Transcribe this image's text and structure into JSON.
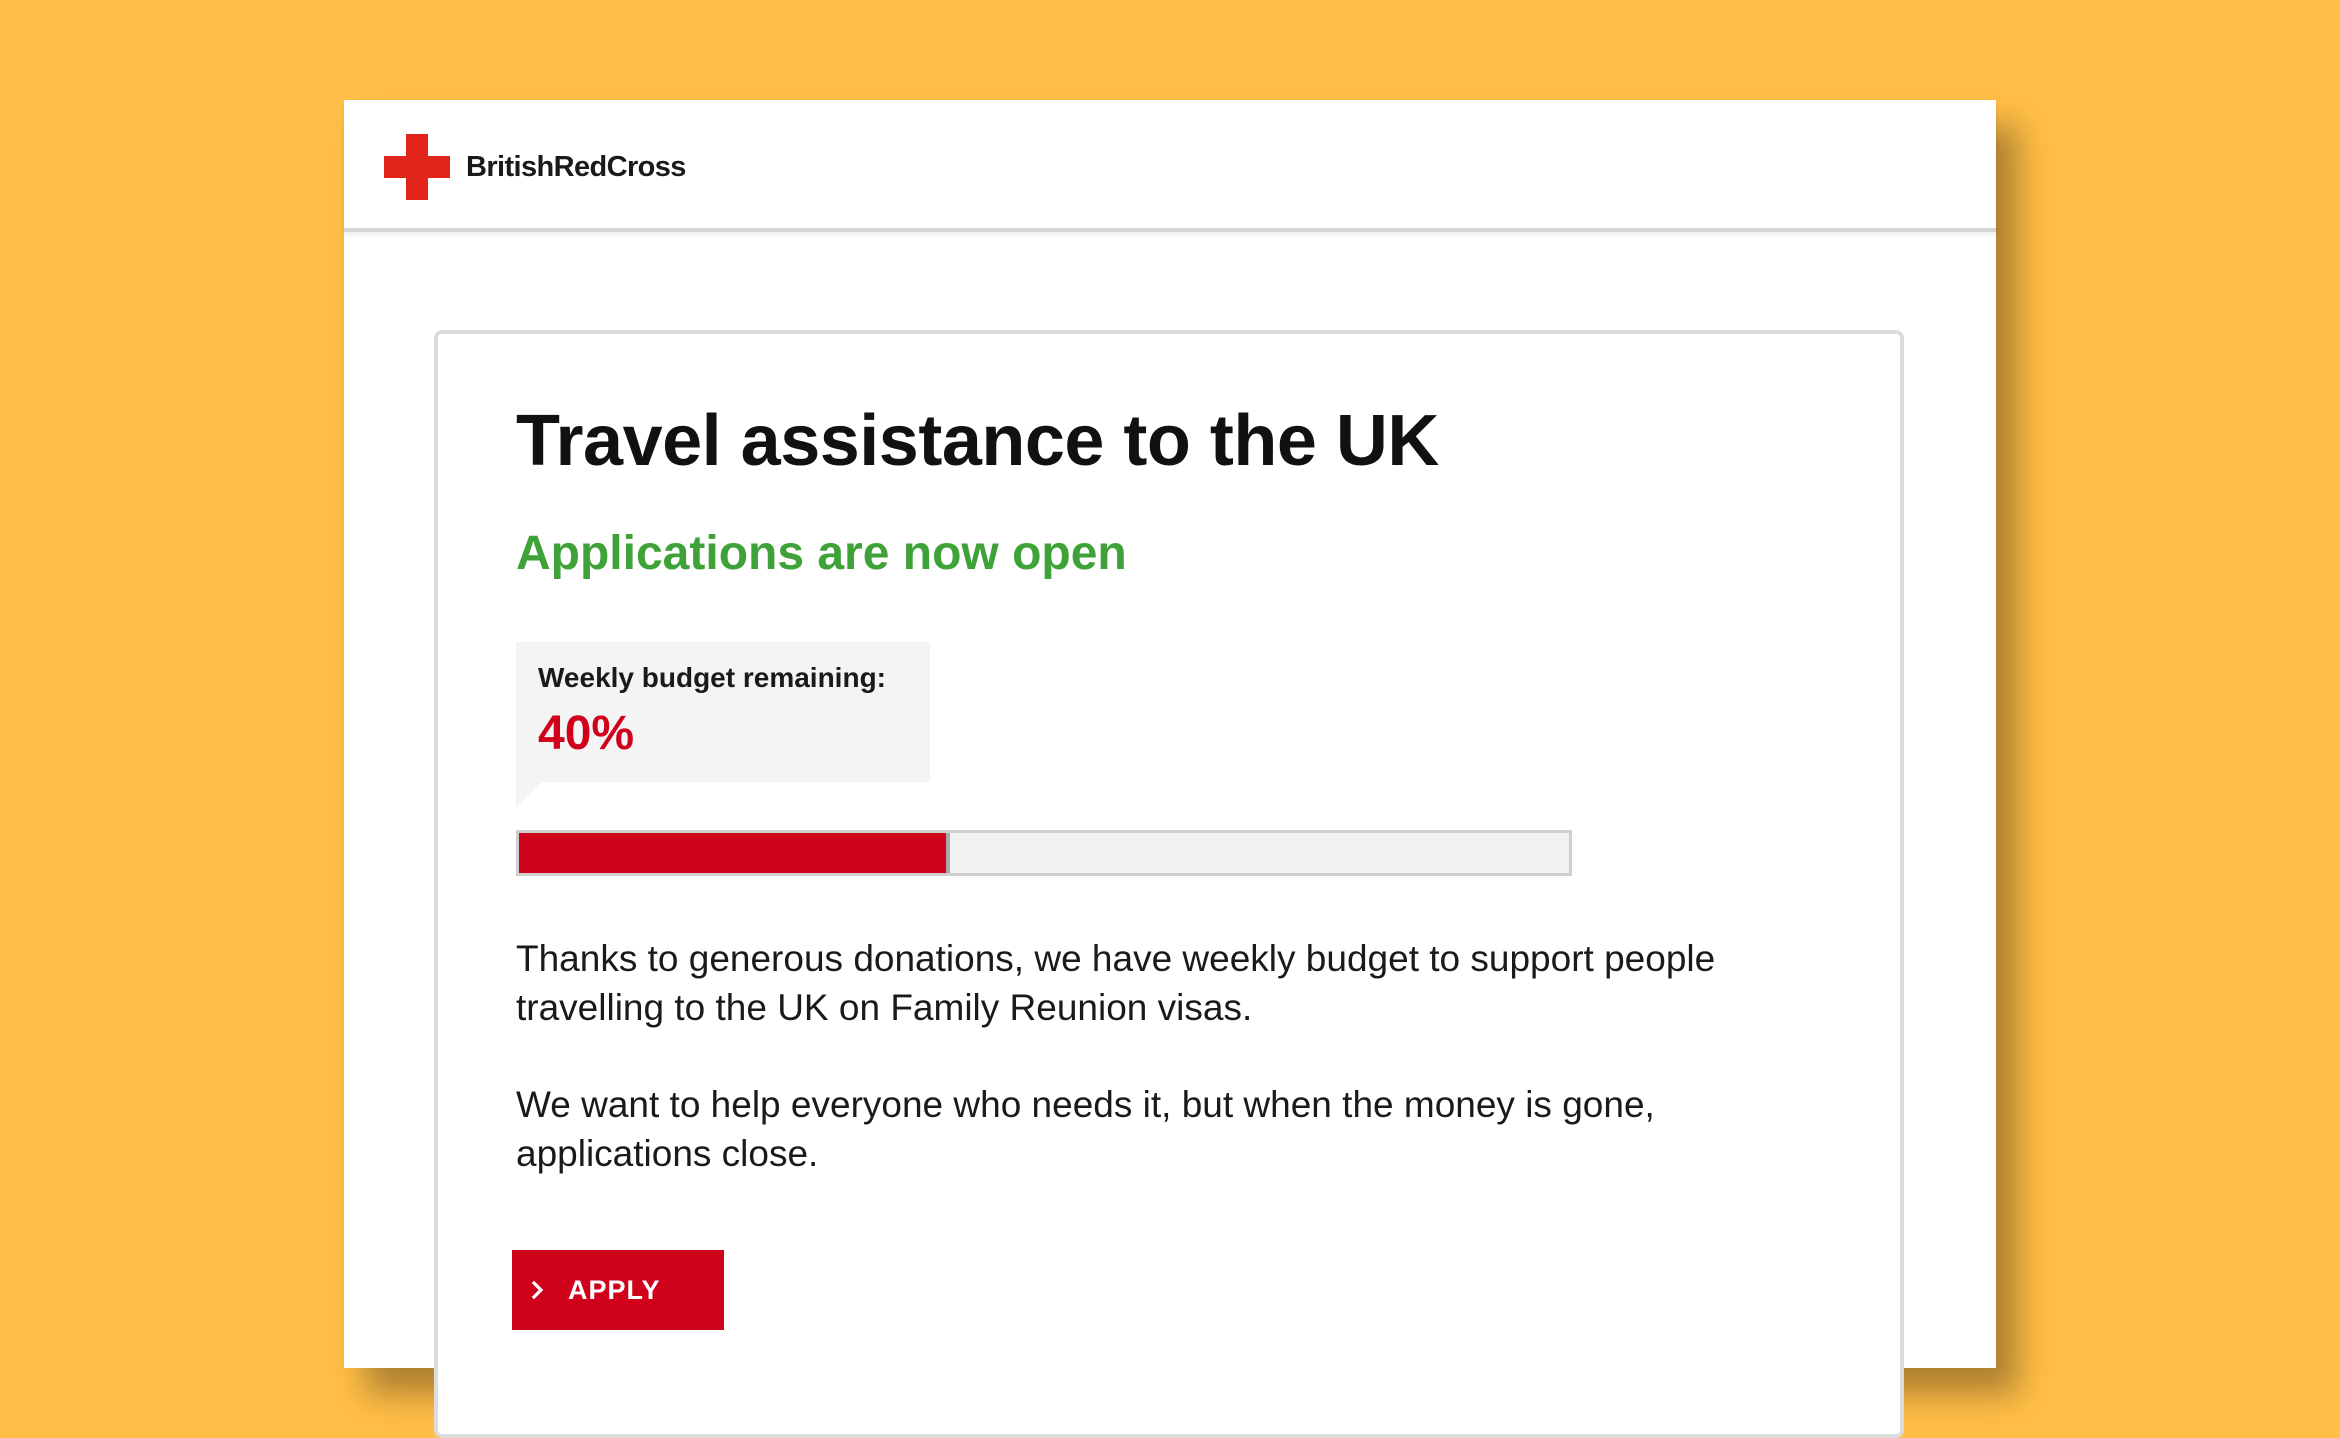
{
  "header": {
    "logo_text": "BritishRedCross"
  },
  "main": {
    "title": "Travel assistance to the UK",
    "status": "Applications are now open",
    "budget": {
      "label": "Weekly budget remaining:",
      "value_text": "40%",
      "remaining_fraction": 0.41
    },
    "paragraphs": [
      "Thanks to generous donations, we have weekly budget to support people travelling to the UK on Family Reunion visas.",
      "We want to help everyone who needs it, but when the money is gone, applications close."
    ],
    "apply_button": {
      "label": "APPLY",
      "icon": "chevron-right-icon"
    }
  },
  "colors": {
    "background": "#FFBE46",
    "brand_red": "#E1251B",
    "accent_red": "#D0021B",
    "status_green": "#3EA238"
  }
}
